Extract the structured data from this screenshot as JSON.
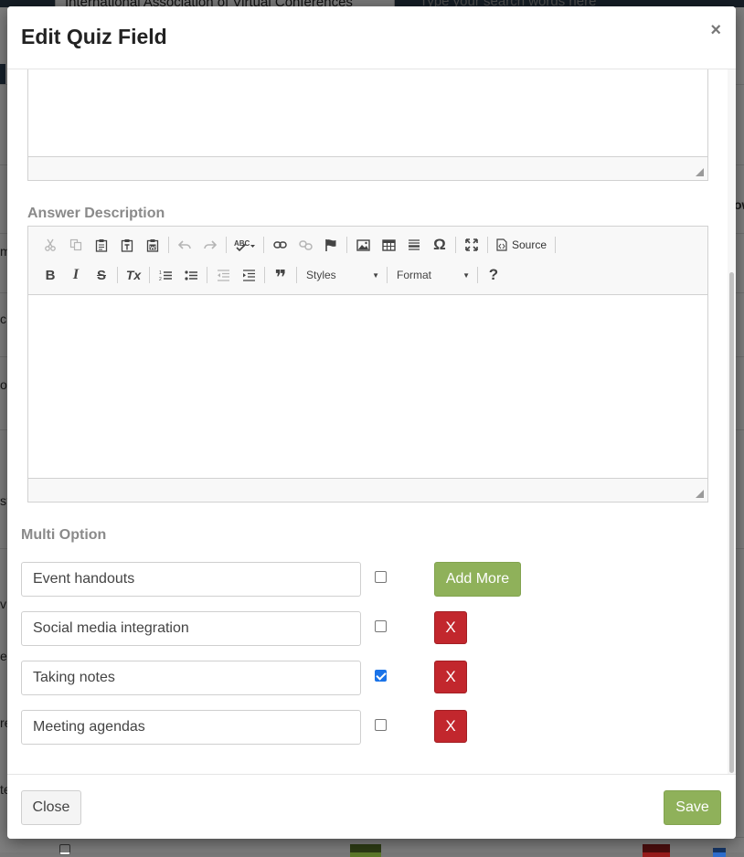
{
  "background": {
    "org_select": "International Association of Virtual Conferences",
    "search_placeholder": "Type your search words here",
    "left_fragments": [
      "m",
      "c",
      "o",
      "s?",
      "v",
      "er",
      "re",
      "te"
    ],
    "right_fragment": "ow"
  },
  "modal": {
    "title": "Edit Quiz Field",
    "close_symbol": "×"
  },
  "answer_description": {
    "label": "Answer Description",
    "toolbar": {
      "source_label": "Source",
      "styles_label": "Styles",
      "format_label": "Format",
      "row1_icons": [
        "cut-icon",
        "copy-icon",
        "paste-icon",
        "paste-text-icon",
        "paste-word-icon",
        "undo-icon",
        "redo-icon",
        "spellcheck-icon",
        "link-icon",
        "unlink-icon",
        "anchor-icon",
        "image-icon",
        "table-icon",
        "horizontal-rule-icon",
        "special-char-icon",
        "maximize-icon",
        "source-icon"
      ],
      "row2_icons": [
        "bold-icon",
        "italic-icon",
        "strike-icon",
        "remove-format-icon",
        "numbered-list-icon",
        "bulleted-list-icon",
        "outdent-icon",
        "indent-icon",
        "blockquote-icon",
        "help-icon"
      ],
      "special_char_glyph": "Ω",
      "help_glyph": "?",
      "blockquote_glyph": "❞",
      "bold_glyph": "B",
      "italic_glyph": "I",
      "strike_glyph": "S",
      "remove_format_glyph": "Tx"
    }
  },
  "multi_option": {
    "label": "Multi Option",
    "add_more_label": "Add More",
    "remove_label": "X",
    "options": [
      {
        "value": "Event handouts",
        "checked": false
      },
      {
        "value": "Social media integration",
        "checked": false
      },
      {
        "value": "Taking notes",
        "checked": true
      },
      {
        "value": "Meeting agendas",
        "checked": false
      }
    ]
  },
  "footer": {
    "close_label": "Close",
    "save_label": "Save"
  },
  "colors": {
    "accent_green": "#8fb15a",
    "danger_red": "#c2272d",
    "checkbox_blue": "#1a73e8"
  }
}
